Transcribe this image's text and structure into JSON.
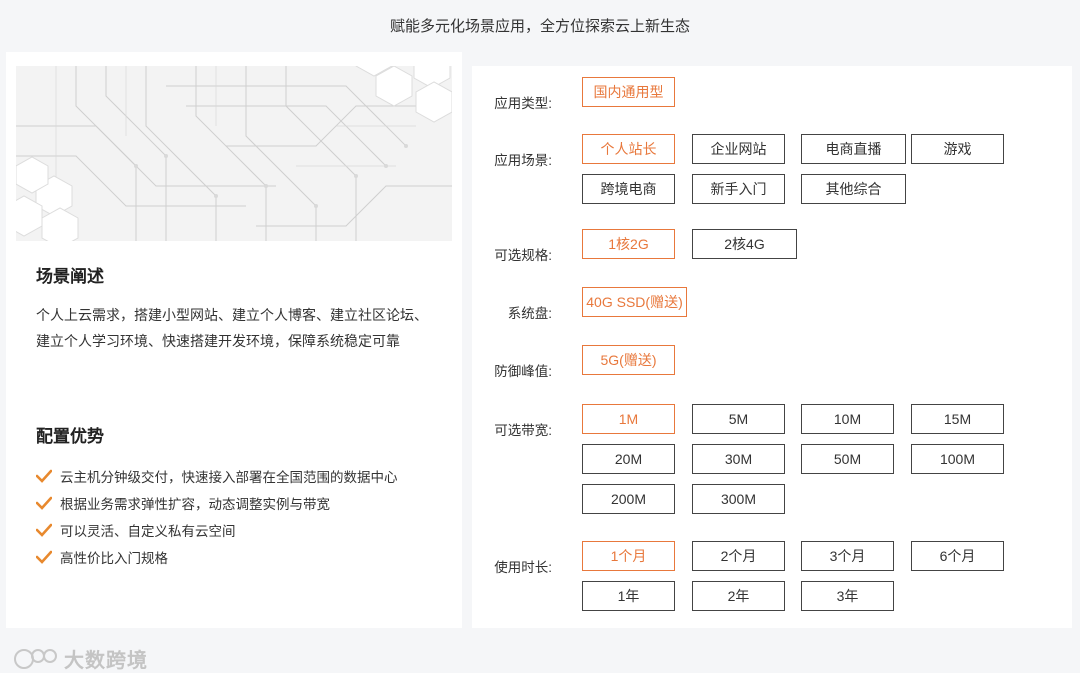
{
  "header": {
    "title": "赋能多元化场景应用，全方位探索云上新生态"
  },
  "left": {
    "scene_title": "场景阐述",
    "scene_desc": "个人上云需求，搭建小型网站、建立个人博客、建立社区论坛、建立个人学习环境、快速搭建开发环境，保障系统稳定可靠",
    "adv_title": "配置优势",
    "advantages": [
      "云主机分钟级交付，快速接入部署在全国范围的数据中心",
      "根据业务需求弹性扩容，动态调整实例与带宽",
      "可以灵活、自定义私有云空间",
      "高性价比入门规格"
    ],
    "watermark": "大数跨境"
  },
  "config": {
    "app_type": {
      "label": "应用类型:",
      "options": [
        "国内通用型"
      ],
      "selected": 0
    },
    "scene": {
      "label": "应用场景:",
      "options": [
        "个人站长",
        "企业网站",
        "电商直播",
        "游戏",
        "跨境电商",
        "新手入门",
        "其他综合"
      ],
      "selected": 0
    },
    "spec": {
      "label": "可选规格:",
      "options": [
        "1核2G",
        "2核4G"
      ],
      "selected": 0
    },
    "disk": {
      "label": "系统盘:",
      "options": [
        "40G SSD(赠送)"
      ],
      "selected": 0
    },
    "ddos": {
      "label": "防御峰值:",
      "options": [
        "5G(赠送)"
      ],
      "selected": 0
    },
    "bandwidth": {
      "label": "可选带宽:",
      "options": [
        "1M",
        "5M",
        "10M",
        "15M",
        "20M",
        "30M",
        "50M",
        "100M",
        "200M",
        "300M"
      ],
      "selected": 0
    },
    "duration": {
      "label": "使用时长:",
      "options": [
        "1个月",
        "2个月",
        "3个月",
        "6个月",
        "1年",
        "2年",
        "3年"
      ],
      "selected": 0
    }
  },
  "colors": {
    "accent": "#e8783c",
    "border": "#444444",
    "check": "#e8892e"
  }
}
